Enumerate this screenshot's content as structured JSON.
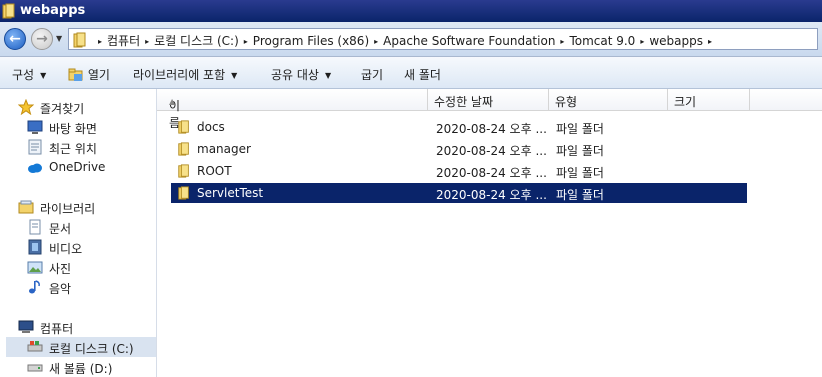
{
  "window": {
    "title": "webapps"
  },
  "address": {
    "crumbs": [
      "컴퓨터",
      "로컬 디스크 (C:)",
      "Program Files (x86)",
      "Apache Software Foundation",
      "Tomcat 9.0",
      "webapps"
    ]
  },
  "toolbar": {
    "organize": "구성",
    "open": "열기",
    "include_library": "라이브러리에 포함",
    "share": "공유 대상",
    "burn": "굽기",
    "new_folder": "새 폴더"
  },
  "sidebar": {
    "favorites": {
      "label": "즐겨찾기",
      "items": [
        "바탕 화면",
        "최근 위치"
      ]
    },
    "onedrive": "OneDrive",
    "libraries": {
      "label": "라이브러리",
      "items": [
        "문서",
        "비디오",
        "사진",
        "음악"
      ]
    },
    "computer": {
      "label": "컴퓨터",
      "items": [
        "로컬 디스크 (C:)",
        "새 볼륨 (D:)"
      ]
    }
  },
  "columns": {
    "name": "이름",
    "modified": "수정한 날짜",
    "type": "유형",
    "size": "크기"
  },
  "files": [
    {
      "name": "docs",
      "date": "2020-08-24 오후 ...",
      "type": "파일 폴더"
    },
    {
      "name": "manager",
      "date": "2020-08-24 오후 ...",
      "type": "파일 폴더"
    },
    {
      "name": "ROOT",
      "date": "2020-08-24 오후 ...",
      "type": "파일 폴더"
    },
    {
      "name": "ServletTest",
      "date": "2020-08-24 오후 ...",
      "type": "파일 폴더"
    }
  ],
  "colors": {
    "selection": "#0a246a",
    "titlebar": "#0a246a"
  }
}
